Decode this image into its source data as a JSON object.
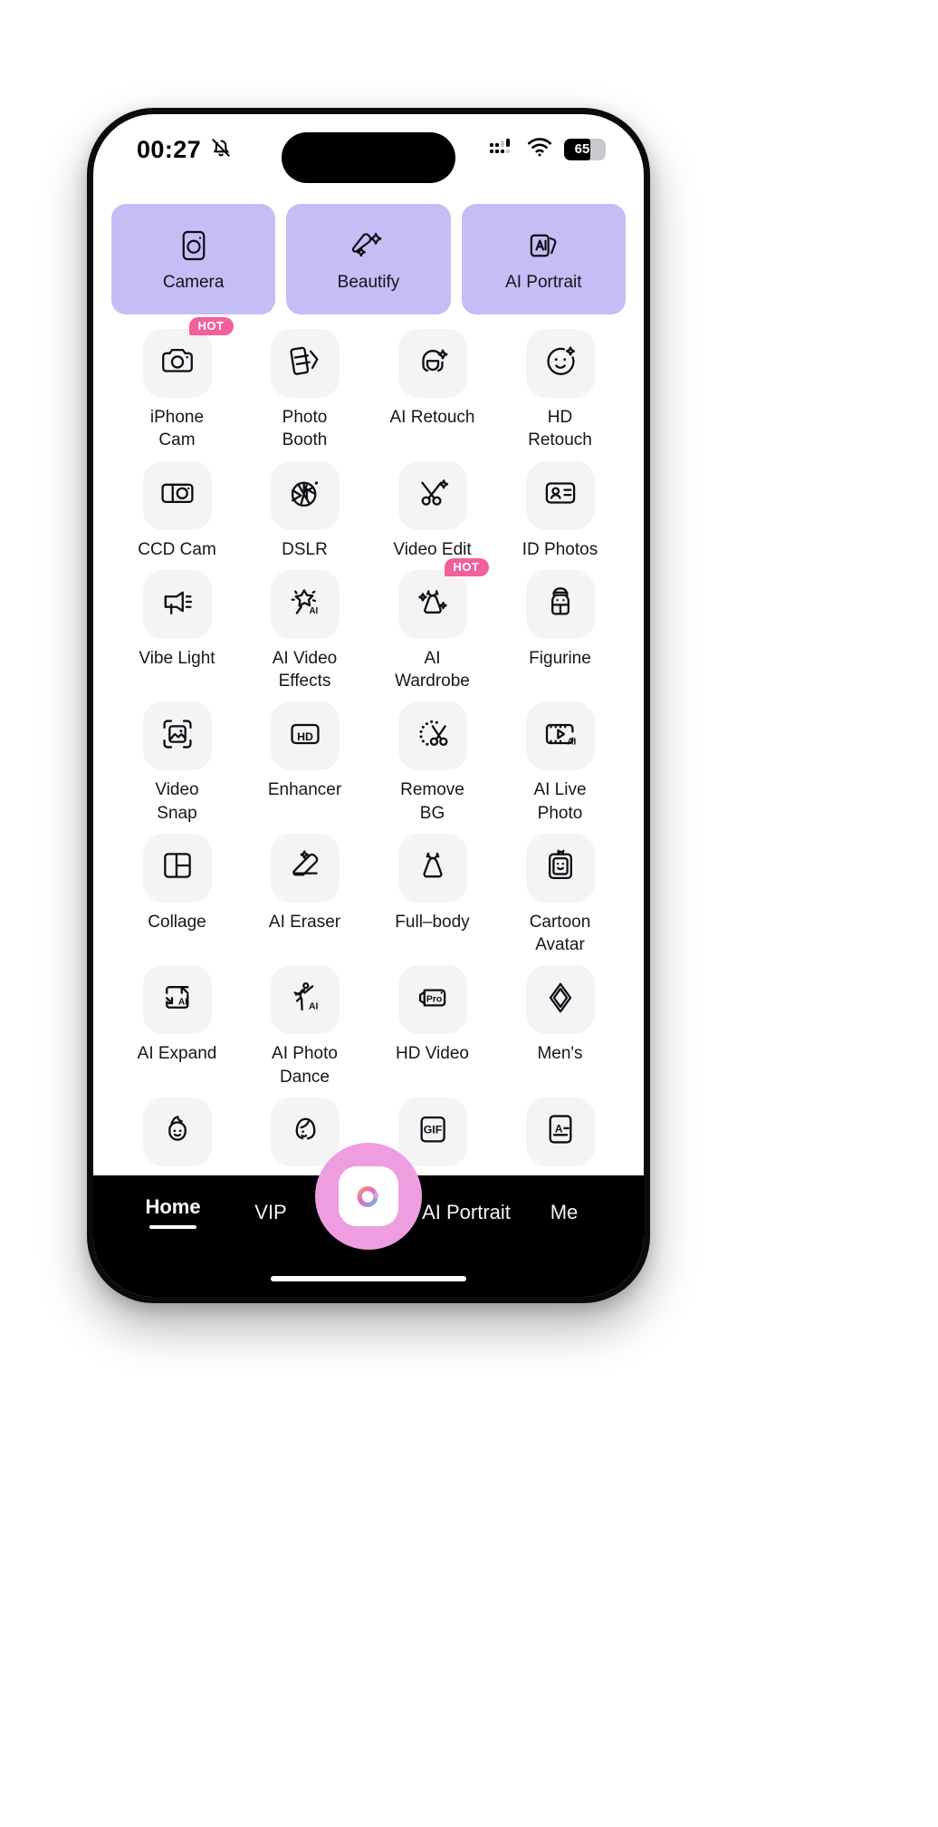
{
  "status_bar": {
    "time": "00:27",
    "mute_icon": "bell-slash-icon",
    "signal_icon": "cellular-signal-icon",
    "wifi_icon": "wifi-icon",
    "battery_level": "65",
    "battery_fill_percent": 64
  },
  "colors": {
    "card_lavender": "#c4bdf6",
    "tile_gray": "#f4f4f6",
    "hot_pink": "#f2609b",
    "fab_pink": "#ee9ee0",
    "tabbar_black": "#000000",
    "text_dark": "#16161c"
  },
  "feature_cards": [
    {
      "label": "Camera",
      "icon": "camera-frame-icon"
    },
    {
      "label": "Beautify",
      "icon": "magic-brush-icon"
    },
    {
      "label": "AI Portrait",
      "icon": "ai-cards-icon"
    }
  ],
  "tools": [
    {
      "label": "iPhone\nCam",
      "icon": "photo-camera-icon",
      "badge": "HOT"
    },
    {
      "label": "Photo\nBooth",
      "icon": "photo-strip-icon",
      "badge": ""
    },
    {
      "label": "AI Retouch",
      "icon": "face-sparkle-icon",
      "badge": ""
    },
    {
      "label": "HD\nRetouch",
      "icon": "smiley-sparkle-icon",
      "badge": ""
    },
    {
      "label": "CCD Cam",
      "icon": "ccd-camera-icon",
      "badge": ""
    },
    {
      "label": "DSLR",
      "icon": "aperture-icon",
      "badge": ""
    },
    {
      "label": "Video Edit",
      "icon": "scissors-sparkle-icon",
      "badge": ""
    },
    {
      "label": "ID Photos",
      "icon": "id-card-icon",
      "badge": ""
    },
    {
      "label": "Vibe Light",
      "icon": "studio-light-icon",
      "badge": ""
    },
    {
      "label": "AI Video\nEffects",
      "icon": "star-ai-icon",
      "badge": ""
    },
    {
      "label": "AI\nWardrobe",
      "icon": "dress-sparkle-icon",
      "badge": "HOT"
    },
    {
      "label": "Figurine",
      "icon": "figurine-icon",
      "badge": ""
    },
    {
      "label": "Video\nSnap",
      "icon": "image-crop-icon",
      "badge": ""
    },
    {
      "label": "Enhancer",
      "icon": "hd-box-icon",
      "badge": ""
    },
    {
      "label": "Remove\nBG",
      "icon": "cutout-scissors-icon",
      "badge": ""
    },
    {
      "label": "AI Live\nPhoto",
      "icon": "film-play-ai-icon",
      "badge": ""
    },
    {
      "label": "Collage",
      "icon": "collage-grid-icon",
      "badge": ""
    },
    {
      "label": "AI Eraser",
      "icon": "eraser-sparkle-icon",
      "badge": ""
    },
    {
      "label": "Full–body",
      "icon": "dress-icon",
      "badge": ""
    },
    {
      "label": "Cartoon\nAvatar",
      "icon": "avatar-card-icon",
      "badge": ""
    },
    {
      "label": "AI Expand",
      "icon": "expand-ai-icon",
      "badge": ""
    },
    {
      "label": "AI Photo\nDance",
      "icon": "dancer-ai-icon",
      "badge": ""
    },
    {
      "label": "HD Video",
      "icon": "video-pro-icon",
      "badge": ""
    },
    {
      "label": "Men's",
      "icon": "diamond-icon",
      "badge": ""
    },
    {
      "label": "",
      "icon": "boy-face-icon",
      "badge": ""
    },
    {
      "label": "",
      "icon": "girl-face-icon",
      "badge": ""
    },
    {
      "label": "",
      "icon": "gif-box-icon",
      "badge": ""
    },
    {
      "label": "",
      "icon": "text-doc-icon",
      "badge": ""
    }
  ],
  "tab_bar": {
    "tabs": [
      {
        "label": "Home",
        "active": true
      },
      {
        "label": "VIP",
        "active": false
      },
      {
        "label": "AI Portrait",
        "active": false
      },
      {
        "label": "Me",
        "active": false
      }
    ],
    "center_button_icon": "camera-shutter-icon"
  }
}
